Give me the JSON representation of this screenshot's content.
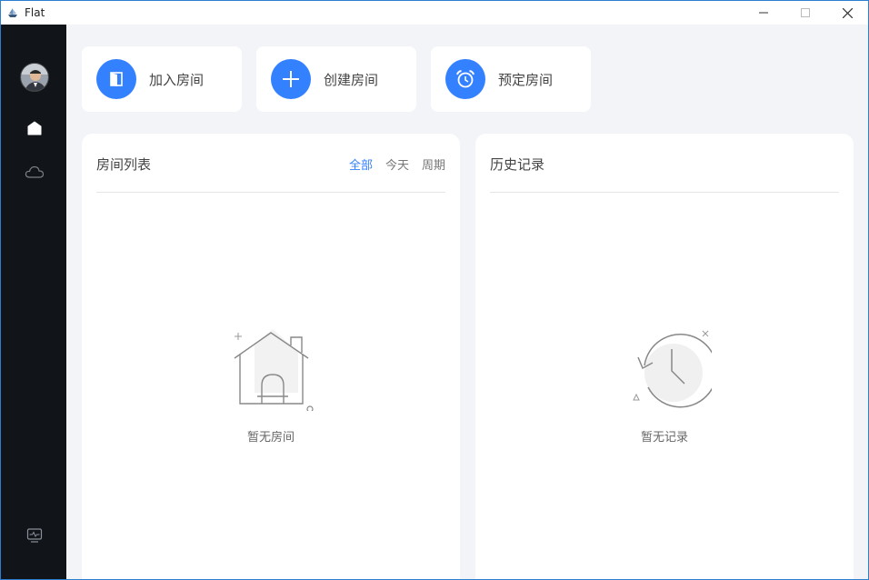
{
  "window": {
    "title": "Flat"
  },
  "actions": [
    {
      "label": "加入房间",
      "icon": "door-icon"
    },
    {
      "label": "创建房间",
      "icon": "plus-icon"
    },
    {
      "label": "预定房间",
      "icon": "alarm-clock-icon"
    }
  ],
  "room_list": {
    "title": "房间列表",
    "filters": [
      "全部",
      "今天",
      "周期"
    ],
    "active_filter": "全部",
    "empty_text": "暂无房间"
  },
  "history": {
    "title": "历史记录",
    "empty_text": "暂无记录"
  },
  "colors": {
    "accent": "#3381ff",
    "sidebar_bg": "#111419",
    "page_bg": "#f3f4f8"
  }
}
